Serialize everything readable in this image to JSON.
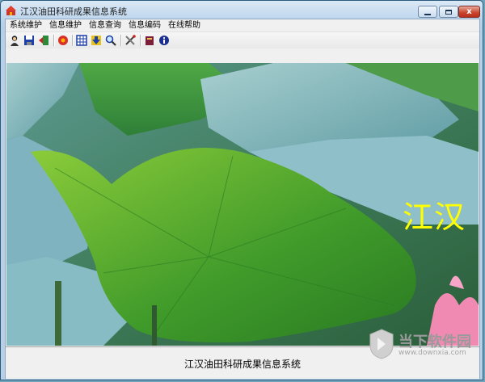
{
  "window": {
    "title": "江汉油田科研成果信息系统",
    "close_label": "x"
  },
  "menubar": {
    "items": [
      "系统维护",
      "信息维护",
      "信息查询",
      "信息编码",
      "在线帮助"
    ]
  },
  "toolbar": {
    "icons": [
      "user-icon",
      "save-icon",
      "exit-door-icon",
      "flower-icon",
      "grid-icon",
      "download-icon",
      "magnifier-search-icon",
      "tools-icon",
      "book-icon",
      "info-icon"
    ]
  },
  "main": {
    "image_caption": "江汉",
    "watermark_color": "#ffff00"
  },
  "statusbar": {
    "text": "江汉油田科研成果信息系统"
  },
  "brand": {
    "name": "当下软件园",
    "url": "www.downxia.com"
  }
}
